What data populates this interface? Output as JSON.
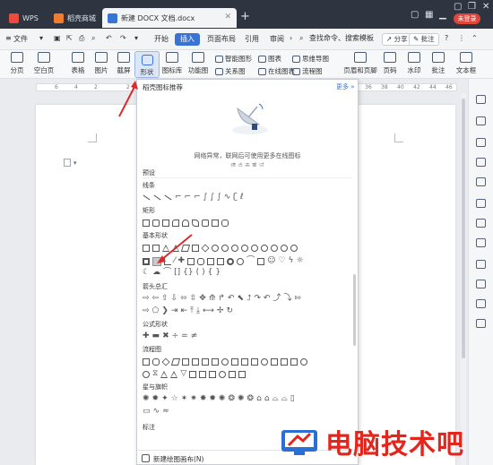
{
  "titlebar": {
    "tabs": [
      {
        "label": "WPS",
        "icon": "wps-logo-icon"
      },
      {
        "label": "稻壳商城",
        "icon": "docer-store-icon"
      },
      {
        "label": "新建 DOCX 文档.docx",
        "icon": "word-doc-icon"
      }
    ],
    "new_tab": "+",
    "login_label": "未登录"
  },
  "menu": {
    "file": "文件",
    "items": [
      "开始",
      "插入",
      "页面布局",
      "引用",
      "审阅"
    ],
    "active": "插入",
    "search": "查找命令、搜索模板",
    "share": "分享",
    "comment": "批注",
    "help": "?"
  },
  "ribbon": {
    "page_break": "分页",
    "blank_page": "空白页",
    "table": "表格",
    "picture": "图片",
    "screenshot": "截屏",
    "shape": "形状",
    "icon_lib": "图标库",
    "func_chart": "功能图",
    "smart_shape": "智能图形",
    "chart": "图表",
    "mind_map": "思维导图",
    "relation_map": "关系图",
    "online_chart": "在线图表",
    "flowchart": "流程图",
    "header_footer": "页眉和页脚",
    "page_number": "页码",
    "watermark": "水印",
    "comment": "批注",
    "textbox": "文本框"
  },
  "ruler": [
    "6",
    "4",
    "2",
    "2",
    "4",
    "6",
    "36",
    "38",
    "40",
    "42",
    "44",
    "46"
  ],
  "panel": {
    "title": "稻壳图标推荐",
    "more": "更多 »",
    "network_msg": "网络异常，联网后可使用更多在线图标",
    "network_cut": "请 点 击 重 试",
    "preset": "预设",
    "sections": [
      "线条",
      "矩形",
      "基本形状",
      "箭头总汇",
      "公式形状",
      "流程图",
      "星与旗帜",
      "标注"
    ],
    "footer": "新建绘图画布(N)"
  },
  "watermark": {
    "text": "电脑技术吧"
  },
  "colors": {
    "titlebar": "#2e3440",
    "accent": "#3a73d6",
    "login": "#e0453a",
    "arrow": "#d92b2b",
    "watermark": "#e2261d"
  }
}
